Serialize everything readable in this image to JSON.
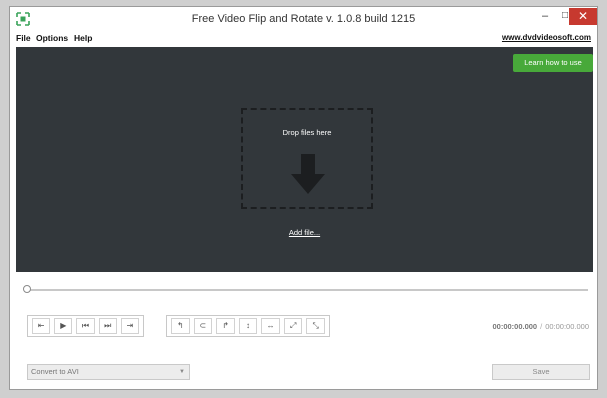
{
  "window": {
    "title": "Free Video Flip and Rotate v. 1.0.8 build 1215",
    "icon": "app-logo-icon",
    "controls": {
      "minimize": "–",
      "maximize": "□",
      "close": "✕"
    }
  },
  "menu": {
    "items": [
      "File",
      "Options",
      "Help"
    ],
    "site_link": "www.dvdvideosoft.com"
  },
  "player": {
    "learn_button": "Learn how to use",
    "drop_text": "Drop files here",
    "drop_icon": "down-arrow-icon",
    "add_file": "Add file...",
    "background": "#32373b",
    "accent": "#48a93a"
  },
  "playback_controls": [
    {
      "name": "prev-frame-icon",
      "glyph": "⇤"
    },
    {
      "name": "play-icon",
      "glyph": "▶"
    },
    {
      "name": "go-start-icon",
      "glyph": "⏮"
    },
    {
      "name": "go-end-icon",
      "glyph": "⏭"
    },
    {
      "name": "next-frame-icon",
      "glyph": "⇥"
    }
  ],
  "transform_controls": [
    {
      "name": "rotate-left-icon",
      "glyph": "↰"
    },
    {
      "name": "rotate-180-icon",
      "glyph": "⊂"
    },
    {
      "name": "rotate-right-icon",
      "glyph": "↱"
    },
    {
      "name": "flip-vertical-icon",
      "glyph": "↕"
    },
    {
      "name": "flip-horizontal-icon",
      "glyph": "↔"
    },
    {
      "name": "transpose-icon",
      "glyph": "⤢"
    },
    {
      "name": "transverse-icon",
      "glyph": "⤡"
    }
  ],
  "time": {
    "current": "00:00:00.000",
    "separator": "/",
    "total": "00:00:00.000"
  },
  "output": {
    "format_selected": "Convert to AVI",
    "save_label": "Save"
  }
}
